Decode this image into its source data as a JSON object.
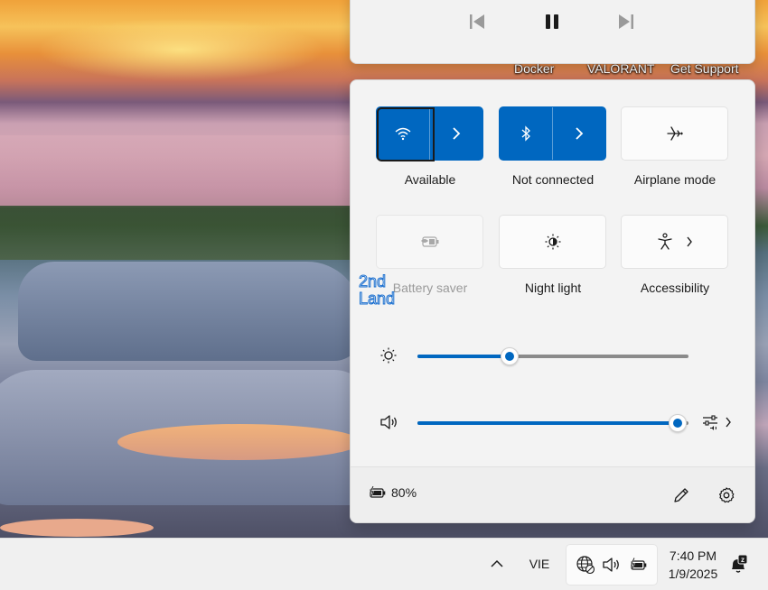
{
  "media": {
    "prev_icon": "previous-track-icon",
    "pause_icon": "pause-icon",
    "next_icon": "next-track-icon"
  },
  "desktop_labels": [
    "Docker",
    "VALORANT",
    "Get Support"
  ],
  "tiles": [
    {
      "label": "Available",
      "icon": "wifi-icon",
      "state": "on",
      "expand": true
    },
    {
      "label": "Not connected",
      "icon": "bluetooth-icon",
      "state": "on",
      "expand": true
    },
    {
      "label": "Airplane mode",
      "icon": "airplane-icon",
      "state": "off",
      "expand": false
    },
    {
      "label": "Battery saver",
      "icon": "battery-saver-icon",
      "state": "disabled",
      "expand": false
    },
    {
      "label": "Night light",
      "icon": "night-light-icon",
      "state": "off",
      "expand": false
    },
    {
      "label": "Accessibility",
      "icon": "accessibility-icon",
      "state": "off",
      "expand": true
    }
  ],
  "brightness": {
    "icon": "brightness-icon",
    "level": 0.34
  },
  "volume": {
    "icon": "speaker-icon",
    "level": 0.96,
    "mixer_icon": "audio-mixer-icon"
  },
  "footer": {
    "battery_icon": "battery-charging-icon",
    "battery_text": "80%",
    "edit_icon": "pencil-icon",
    "settings_icon": "gear-icon"
  },
  "watermark": {
    "line1": "2nd",
    "line2": "Land"
  },
  "taskbar": {
    "overflow_icon": "chevron-up-icon",
    "language": "VIE",
    "tray_icons": [
      "globe-network-icon",
      "speaker-icon",
      "battery-charging-icon"
    ],
    "time": "7:40 PM",
    "date": "1/9/2025",
    "notification_icon": "notification-bell-icon",
    "notification_badge": "z"
  },
  "colors": {
    "accent": "#0067c0",
    "panel": "#f3f3f3",
    "taskbar": "#f0f0f0"
  }
}
